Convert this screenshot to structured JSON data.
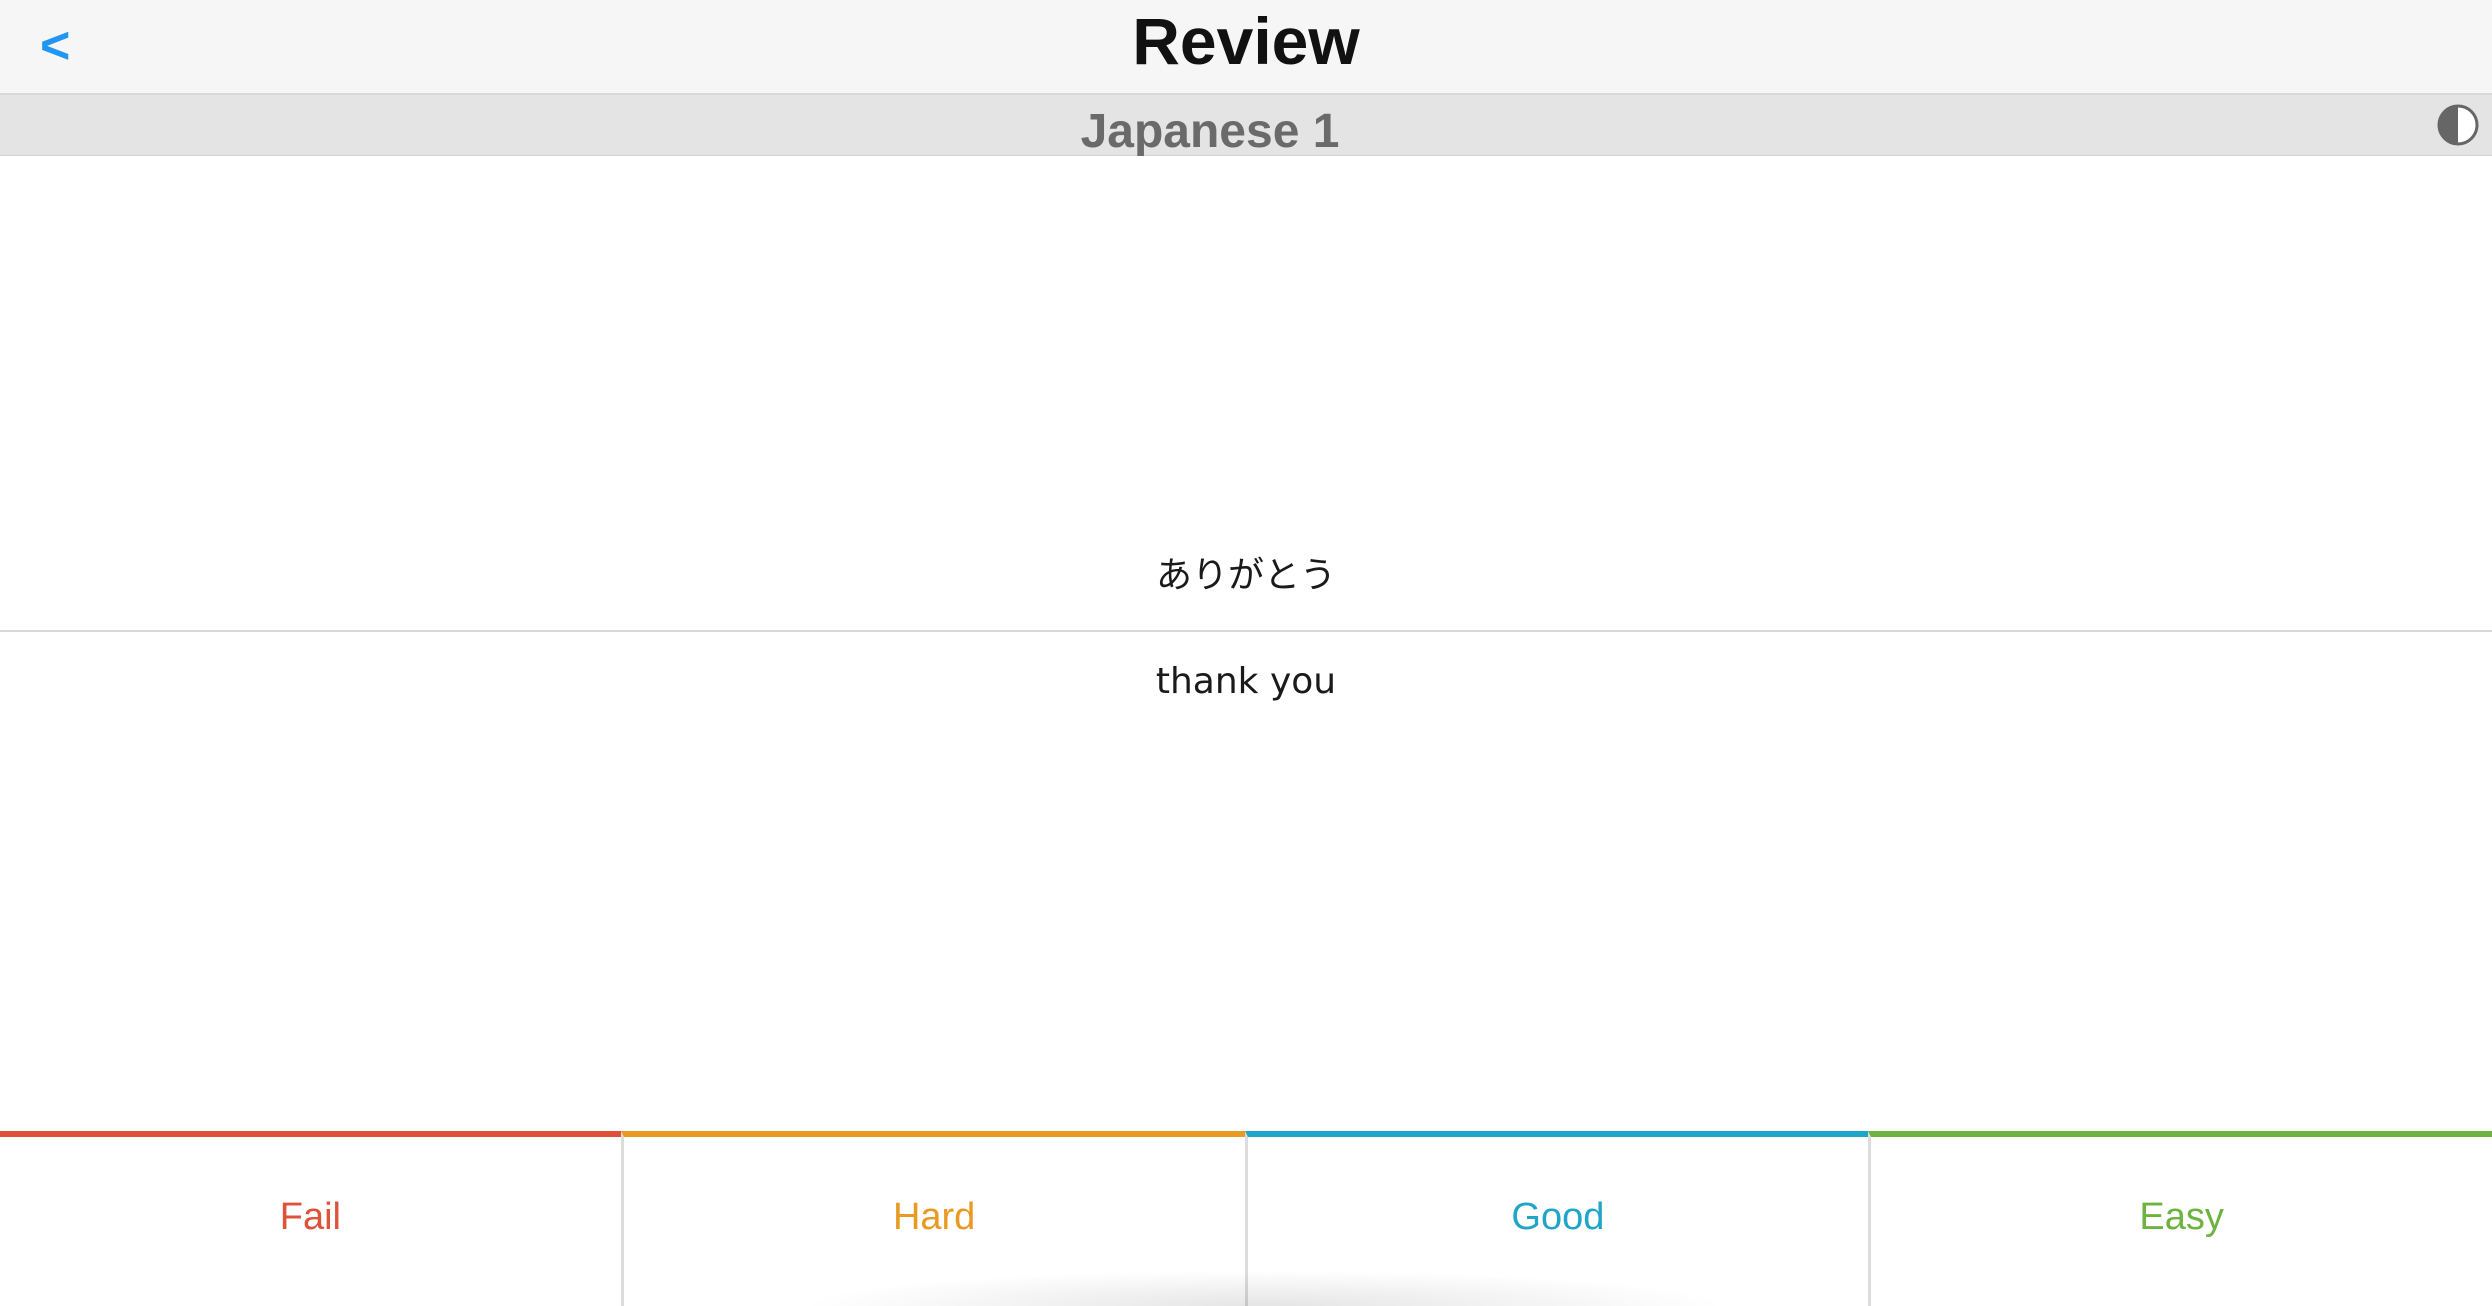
{
  "header": {
    "back_label": "<",
    "title": "Review"
  },
  "subheader": {
    "deck_name": "Japanese 1",
    "theme_toggle_icon": "contrast-icon"
  },
  "card": {
    "front": "ありがとう",
    "back": "thank you"
  },
  "answers": [
    {
      "label": "Fail",
      "color": "#e0513a"
    },
    {
      "label": "Hard",
      "color": "#e89a22"
    },
    {
      "label": "Good",
      "color": "#1fa5c8"
    },
    {
      "label": "Easy",
      "color": "#6eb33f"
    }
  ],
  "colors": {
    "accent": "#2196f3"
  }
}
